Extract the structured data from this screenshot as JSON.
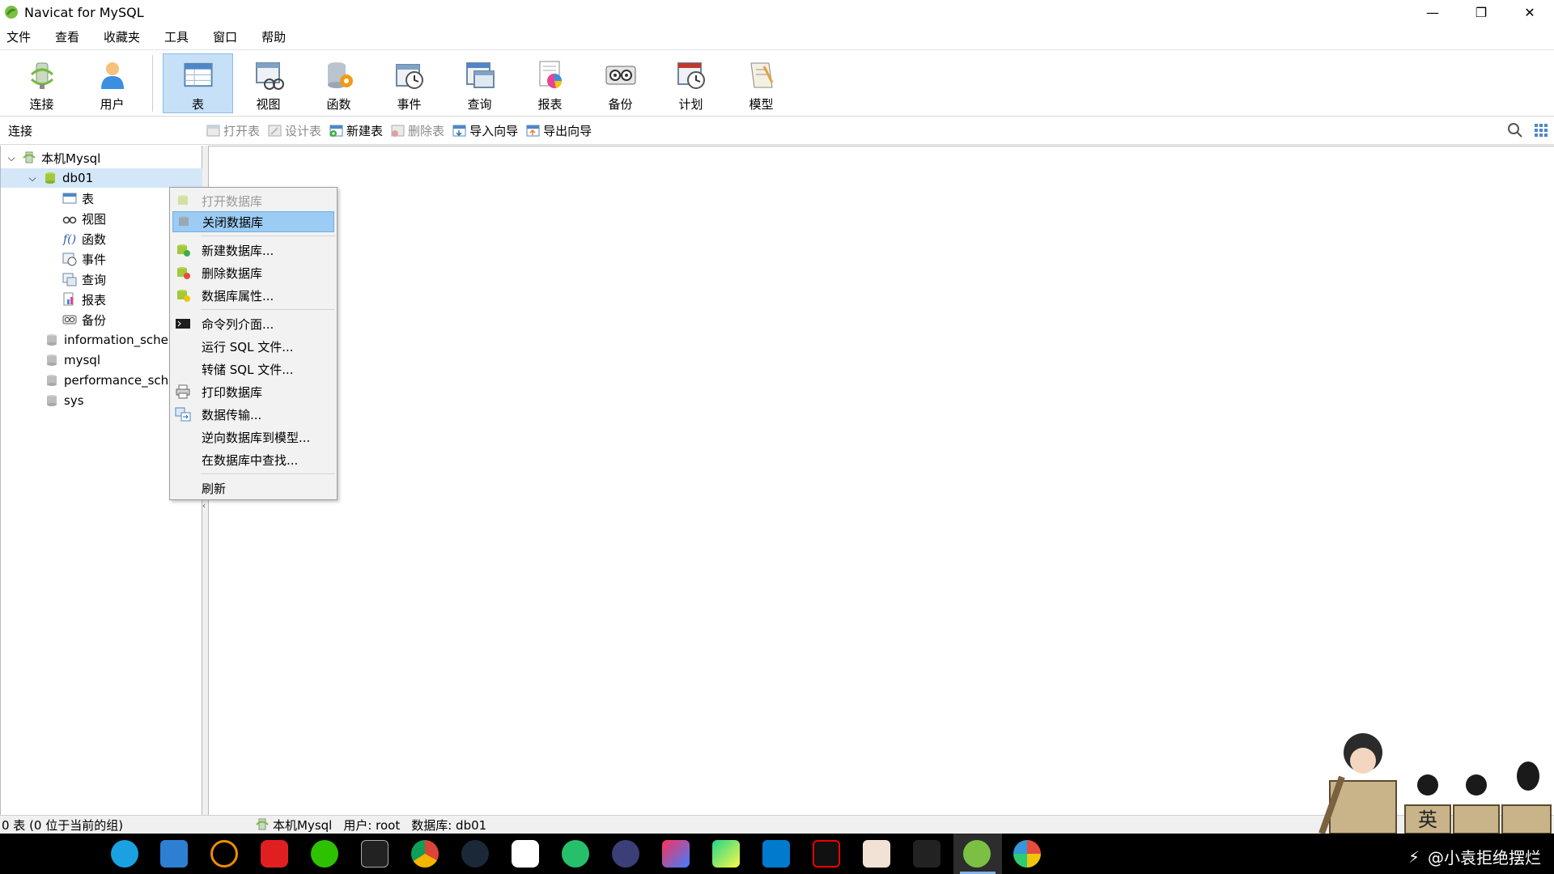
{
  "window": {
    "title": "Navicat for MySQL",
    "controls": [
      "—",
      "❐",
      "✕"
    ]
  },
  "menubar": [
    "文件",
    "查看",
    "收藏夹",
    "工具",
    "窗口",
    "帮助"
  ],
  "toolbar": [
    {
      "label": "连接",
      "icon": "connection-icon"
    },
    {
      "label": "用户",
      "icon": "user-icon"
    },
    {
      "label": "表",
      "icon": "table-icon",
      "active": true
    },
    {
      "label": "视图",
      "icon": "view-icon"
    },
    {
      "label": "函数",
      "icon": "function-icon"
    },
    {
      "label": "事件",
      "icon": "event-icon"
    },
    {
      "label": "查询",
      "icon": "query-icon"
    },
    {
      "label": "报表",
      "icon": "report-icon"
    },
    {
      "label": "备份",
      "icon": "backup-icon"
    },
    {
      "label": "计划",
      "icon": "schedule-icon"
    },
    {
      "label": "模型",
      "icon": "model-icon"
    }
  ],
  "subbar": {
    "connection_label": "连接",
    "buttons": [
      {
        "label": "打开表",
        "enabled": false
      },
      {
        "label": "设计表",
        "enabled": false
      },
      {
        "label": "新建表",
        "enabled": true
      },
      {
        "label": "删除表",
        "enabled": false
      },
      {
        "label": "导入向导",
        "enabled": true
      },
      {
        "label": "导出向导",
        "enabled": true
      }
    ]
  },
  "tree": {
    "connection": "本机Mysql",
    "database": "db01",
    "children": [
      "表",
      "视图",
      "函数",
      "事件",
      "查询",
      "报表",
      "备份"
    ],
    "other_dbs": [
      "information_schema",
      "mysql",
      "performance_schema",
      "sys"
    ]
  },
  "context_menu": [
    {
      "label": "打开数据库",
      "enabled": false
    },
    {
      "label": "关闭数据库",
      "highlighted": true
    },
    {
      "label": "新建数据库..."
    },
    {
      "label": "删除数据库"
    },
    {
      "label": "数据库属性..."
    },
    {
      "label": "命令列介面..."
    },
    {
      "label": "运行 SQL 文件..."
    },
    {
      "label": "转储 SQL 文件..."
    },
    {
      "label": "打印数据库"
    },
    {
      "label": "数据传输..."
    },
    {
      "label": "逆向数据库到模型..."
    },
    {
      "label": "在数据库中查找..."
    },
    {
      "label": "刷新"
    }
  ],
  "statusbar": {
    "count": "0 表 (0 位于当前的组)",
    "connection": "本机Mysql",
    "user": "用户: root",
    "database": "数据库: db01"
  },
  "tray": {
    "watermark": "@小袁拒绝摆烂",
    "ime": "英"
  },
  "colors": {
    "active_tool": "#c5e0f7",
    "menu_highlight": "#9ccbf3",
    "selected_node": "#d3e7f9"
  }
}
